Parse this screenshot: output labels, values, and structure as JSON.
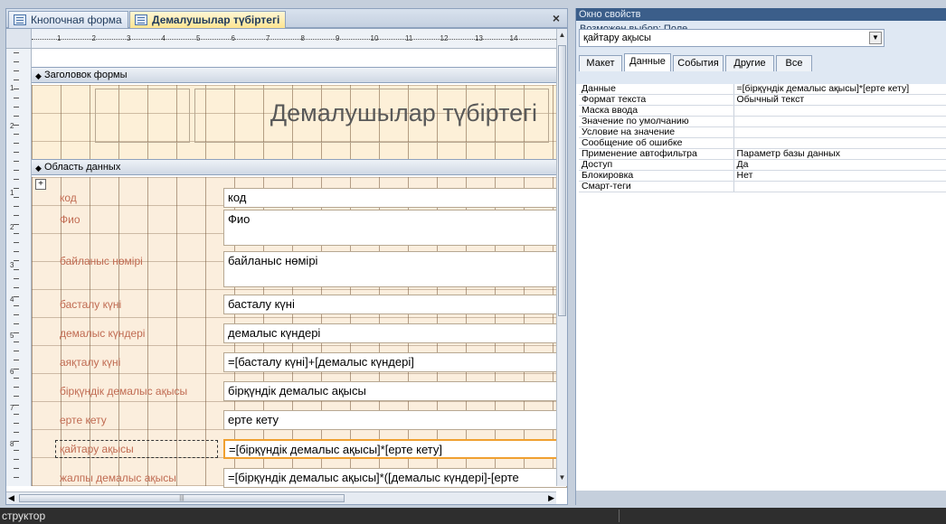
{
  "tabs": [
    {
      "label": "Кнопочная форма",
      "active": false
    },
    {
      "label": "Демалушылар түбіртегі",
      "active": true
    }
  ],
  "close_glyph": "×",
  "ruler": {
    "top_numbers": [
      "1",
      "2",
      "3",
      "4",
      "5",
      "6",
      "7",
      "8",
      "9",
      "10",
      "11",
      "12",
      "13",
      "14"
    ],
    "left_numbers": [
      "1",
      "2",
      "1",
      "2",
      "3",
      "4",
      "5",
      "6",
      "7",
      "8"
    ]
  },
  "sections": {
    "header": "Заголовок формы",
    "detail": "Область данных"
  },
  "form_title": "Демалушылар түбіртегі",
  "fields": [
    {
      "label": "код",
      "value": "код",
      "tall": false,
      "selected": false
    },
    {
      "label": "Фио",
      "value": "Фио",
      "tall": true,
      "selected": false
    },
    {
      "label": "байланыс нөмірі",
      "value": "байланыс нөмірі",
      "tall": true,
      "selected": false
    },
    {
      "label": "басталу күні",
      "value": "басталу күні",
      "tall": false,
      "selected": false
    },
    {
      "label": "демалыс күндері",
      "value": "демалыс күндері",
      "tall": false,
      "selected": false
    },
    {
      "label": "аяқталу күні",
      "value": "=[басталу күні]+[демалыс күндері]",
      "tall": false,
      "selected": false
    },
    {
      "label": "бірқүндік демалыс ақысы",
      "value": "бірқүндік демалыс ақысы",
      "tall": false,
      "selected": false
    },
    {
      "label": "ерте кету",
      "value": "ерте кету",
      "tall": false,
      "selected": false
    },
    {
      "label": "қайтару ақысы",
      "value": "=[бірқүндік демалыс ақысы]*[ерте кету]",
      "tall": false,
      "selected": true
    },
    {
      "label": "жалпы демалыс ақысы",
      "value": "=[бірқүндік демалыс ақысы]*([демалыс күндері]-[ерте",
      "tall": false,
      "selected": false
    }
  ],
  "property_sheet": {
    "title": "Окно свойств",
    "selection_type": "Возможен выбор: Поле",
    "selected_object": "қайтару ақысы",
    "tabs": [
      "Макет",
      "Данные",
      "События",
      "Другие",
      "Все"
    ],
    "active_tab": "Данные",
    "rows": [
      {
        "name": "Данные",
        "value": "=[бірқүндік демалыс ақысы]*[ерте кету]"
      },
      {
        "name": "Формат текста",
        "value": "Обычный текст"
      },
      {
        "name": "Маска ввода",
        "value": ""
      },
      {
        "name": "Значение по умолчанию",
        "value": ""
      },
      {
        "name": "Условие на значение",
        "value": ""
      },
      {
        "name": "Сообщение об ошибке",
        "value": ""
      },
      {
        "name": "Применение автофильтра",
        "value": "Параметр базы данных"
      },
      {
        "name": "Доступ",
        "value": "Да"
      },
      {
        "name": "Блокировка",
        "value": "Нет"
      },
      {
        "name": "Смарт-теги",
        "value": ""
      }
    ]
  },
  "status_text": "структор",
  "colors": {
    "accent": "#f0a030",
    "label_text": "#c06b52",
    "title_bar": "#3b5e8a",
    "grid_bg": "#fbeedd"
  }
}
